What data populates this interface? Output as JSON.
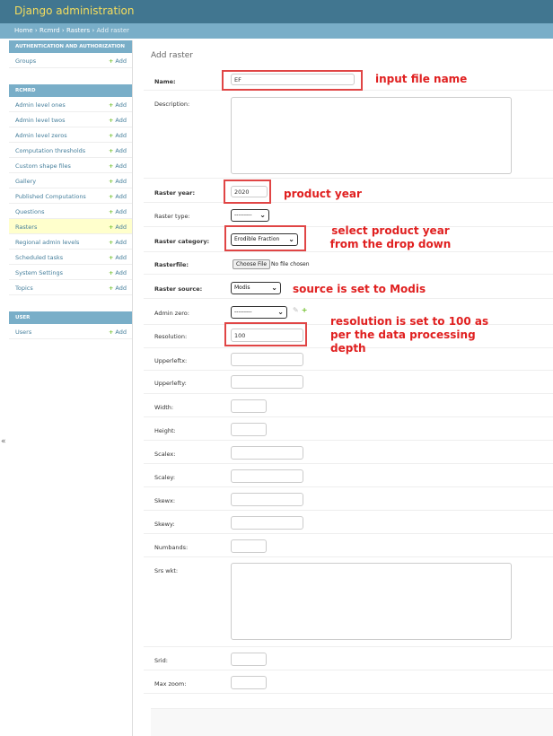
{
  "header": {
    "brand": "Django administration"
  },
  "breadcrumbs": {
    "home": "Home",
    "sep": "›",
    "app": "Rcmrd",
    "model": "Rasters",
    "current": "Add raster"
  },
  "sidebar": {
    "collapse_glyph": "«",
    "add_label": "Add",
    "modules": [
      {
        "caption": "AUTHENTICATION AND AUTHORIZATION",
        "items": [
          "Groups"
        ]
      },
      {
        "caption": "RCMRD",
        "items": [
          "Admin level ones",
          "Admin level twos",
          "Admin level zeros",
          "Computation thresholds",
          "Custom shape files",
          "Gallery",
          "Published Computations",
          "Questions",
          "Rasters",
          "Regional admin levels",
          "Scheduled tasks",
          "System Settings",
          "Topics"
        ]
      },
      {
        "caption": "USER",
        "items": [
          "Users"
        ]
      }
    ],
    "active_item": "Rasters"
  },
  "main": {
    "title": "Add raster"
  },
  "form": {
    "name": {
      "label": "Name:",
      "value": "EF"
    },
    "description": {
      "label": "Description:"
    },
    "raster_year": {
      "label": "Raster year:",
      "value": "2020"
    },
    "raster_type": {
      "label": "Raster type:",
      "value": "---------"
    },
    "raster_category": {
      "label": "Raster category:",
      "value": "Erodible Fraction"
    },
    "rasterfile": {
      "label": "Rasterfile:",
      "button": "Choose File",
      "status": "No file chosen"
    },
    "raster_source": {
      "label": "Raster source:",
      "value": "Modis"
    },
    "admin_zero": {
      "label": "Admin zero:",
      "value": "---------"
    },
    "resolution": {
      "label": "Resolution:",
      "value": "100"
    },
    "upperleftx": {
      "label": "Upperleftx:"
    },
    "upperlefty": {
      "label": "Upperlefty:"
    },
    "width": {
      "label": "Width:"
    },
    "height": {
      "label": "Height:"
    },
    "scalex": {
      "label": "Scalex:"
    },
    "scaley": {
      "label": "Scaley:"
    },
    "skewx": {
      "label": "Skewx:"
    },
    "skewy": {
      "label": "Skewy:"
    },
    "numbands": {
      "label": "Numbands:"
    },
    "srs_wkt": {
      "label": "Srs wkt:"
    },
    "srid": {
      "label": "Srid:"
    },
    "max_zoom": {
      "label": "Max zoom:"
    }
  },
  "annotations": {
    "name": "input file name",
    "year": "product year",
    "category_1": "select product year",
    "category_2": "from the drop down",
    "source": "source is set to Modis",
    "resolution_1": "resolution is set to 100 as",
    "resolution_2": "per the data processing",
    "resolution_3": "depth",
    "color": "#e02020"
  },
  "icons": {
    "chevron": "chevron-down-icon",
    "pencil": "pencil-icon",
    "plus": "plus-icon"
  }
}
